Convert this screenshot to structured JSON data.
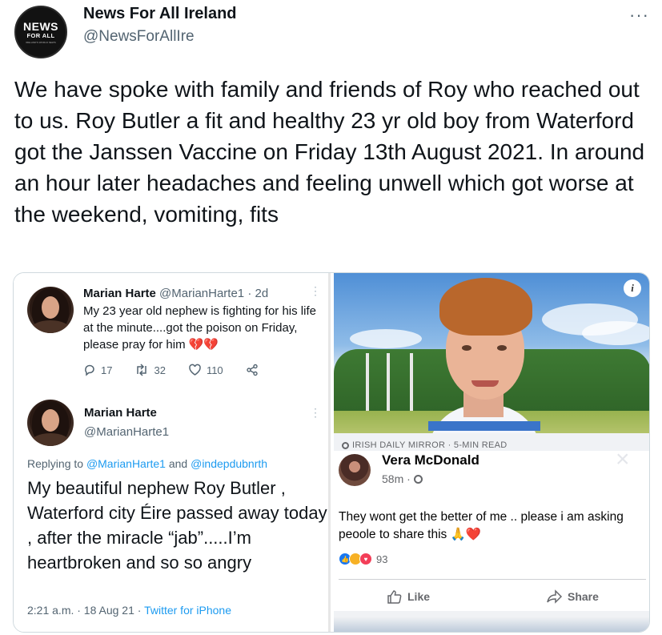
{
  "author": {
    "avatar_text": [
      "NEWS",
      "FOR ALL",
      "IRELAND'S WORLD NEWS"
    ],
    "name": "News For All Ireland",
    "handle": "@NewsForAllIre"
  },
  "more_label": "···",
  "tweet_text": "We have spoke with family and friends of Roy who reached out to us. Roy Butler a fit and healthy 23 yr old boy from Waterford got the Janssen Vaccine on Friday 13th August 2021. In around an hour later headaches and feeling unwell which got worse at the weekend, vomiting, fits",
  "embedded_tweet_1": {
    "name": "Marian Harte",
    "handle_time": "@MarianHarte1 · 2d",
    "dots": "⋮",
    "text": "My 23 year old nephew is fighting for his life at the minute....got the poison on Friday, please pray for him",
    "emoji": "💔💔",
    "replies": "17",
    "retweets": "32",
    "likes": "110"
  },
  "embedded_tweet_2": {
    "name": "Marian Harte",
    "handle": "@MarianHarte1",
    "dots": "⋮",
    "reply_prefix": "Replying to ",
    "reply_mention_1": "@MarianHarte1",
    "reply_and": " and ",
    "reply_mention_2": "@indepdubnrth",
    "text": "My beautiful nephew Roy Butler , Waterford city Éire passed away today , after the miracle “jab”.....I’m heartbroken and so so angry",
    "meta_time": "2:21 a.m. · 18 Aug 21 · ",
    "meta_source": "Twitter for iPhone"
  },
  "article": {
    "info_label": "i",
    "source": "IRISH DAILY MIRROR · 5-MIN READ"
  },
  "fb_post": {
    "name": "Vera McDonald",
    "time": "58m ·",
    "close": "×",
    "text": "They wont get the better of me .. please i am asking peoole to share this",
    "emoji": "🙏❤️",
    "reaction_count": "93",
    "like_label": "Like",
    "share_label": "Share"
  }
}
